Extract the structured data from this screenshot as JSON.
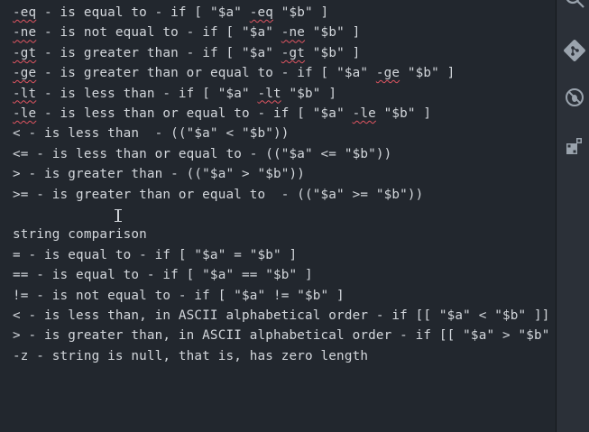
{
  "editor": {
    "lines": [
      {
        "segments": [
          {
            "t": "-eq",
            "s": true
          },
          {
            "t": " - is equal to - if [ \"$a\" "
          },
          {
            "t": "-eq",
            "s": true
          },
          {
            "t": " \"$b\" ]"
          }
        ]
      },
      {
        "segments": [
          {
            "t": "-ne",
            "s": true
          },
          {
            "t": " - is not equal to - if [ \"$a\" "
          },
          {
            "t": "-ne",
            "s": true
          },
          {
            "t": " \"$b\" ]"
          }
        ]
      },
      {
        "segments": [
          {
            "t": "-gt",
            "s": true
          },
          {
            "t": " - is greater than - if [ \"$a\" "
          },
          {
            "t": "-gt",
            "s": true
          },
          {
            "t": " \"$b\" ]"
          }
        ]
      },
      {
        "segments": [
          {
            "t": "-ge",
            "s": true
          },
          {
            "t": " - is greater than or equal to - if [ \"$a\" "
          },
          {
            "t": "-ge",
            "s": true
          },
          {
            "t": " \"$b\" ]"
          }
        ]
      },
      {
        "segments": [
          {
            "t": "-lt",
            "s": true
          },
          {
            "t": " - is less than - if [ \"$a\" "
          },
          {
            "t": "-lt",
            "s": true
          },
          {
            "t": " \"$b\" ]"
          }
        ]
      },
      {
        "segments": [
          {
            "t": "-le",
            "s": true
          },
          {
            "t": " - is less than or equal to - if [ \"$a\" "
          },
          {
            "t": "-le",
            "s": true
          },
          {
            "t": " \"$b\" ]"
          }
        ]
      },
      {
        "segments": [
          {
            "t": "< - is less than  - ((\"$a\" < \"$b\"))"
          }
        ]
      },
      {
        "segments": [
          {
            "t": "<= - is less than or equal to - ((\"$a\" <= \"$b\"))"
          }
        ]
      },
      {
        "segments": [
          {
            "t": "> - is greater than - ((\"$a\" > \"$b\"))"
          }
        ]
      },
      {
        "segments": [
          {
            "t": ">= - is greater than or equal to  - ((\"$a\" >= \"$b\"))"
          }
        ]
      },
      {
        "segments": []
      },
      {
        "segments": [
          {
            "t": "string comparison"
          }
        ]
      },
      {
        "segments": [
          {
            "t": "= - is equal to - if [ \"$a\" = \"$b\" ]"
          }
        ]
      },
      {
        "segments": [
          {
            "t": "== - is equal to - if [ \"$a\" == \"$b\" ]"
          }
        ]
      },
      {
        "segments": [
          {
            "t": "!= - is not equal to - if [ \"$a\" != \"$b\" ]"
          }
        ]
      },
      {
        "segments": [
          {
            "t": "< - is less than, in ASCII alphabetical order - if [[ \"$a\" < \"$b\" ]]"
          }
        ]
      },
      {
        "segments": [
          {
            "t": "> - is greater than, in ASCII alphabetical order - if [[ \"$a\" > \"$b\" ]]"
          }
        ]
      },
      {
        "segments": [
          {
            "t": "-z - string is null, that is, has zero length"
          }
        ]
      }
    ]
  },
  "activity_bar": {
    "icons": [
      "search-icon",
      "source-control-icon",
      "debug-icon",
      "extensions-icon"
    ]
  },
  "colors": {
    "editor_bg": "#22272e",
    "text": "#d3d7dc",
    "squiggle": "#e05561",
    "activity_bar_bg": "#2b3038"
  }
}
